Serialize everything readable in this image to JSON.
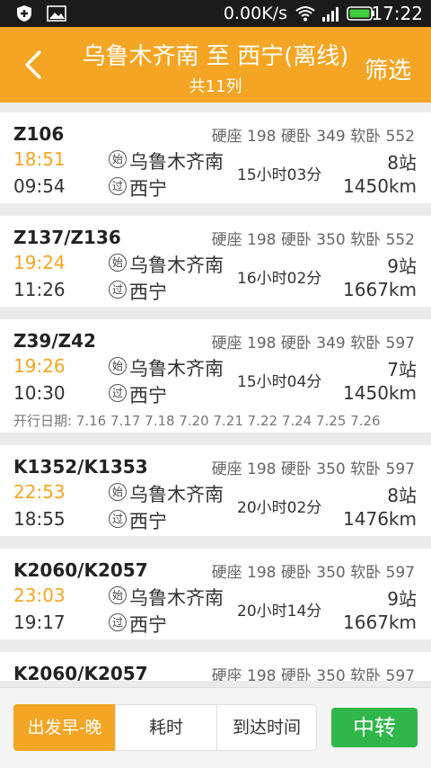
{
  "status_bar": {
    "net_speed": "0.00K/s",
    "time": "17:22",
    "icons": [
      "shield-icon",
      "image-icon",
      "wifi-icon",
      "signal-icon",
      "battery-icon"
    ]
  },
  "header": {
    "title": "乌鲁木齐南 至 西宁(离线)",
    "subtitle": "共11列",
    "filter_label": "筛选",
    "back_icon": "chevron-left-icon",
    "color": "#f4a523"
  },
  "badges": {
    "start": "始",
    "pass": "过"
  },
  "trains": [
    {
      "number": "Z106",
      "prices": "硬座 198 硬卧 349 软卧 552",
      "dep_time": "18:51",
      "arr_time": "09:54",
      "from": "乌鲁木齐南",
      "to": "西宁",
      "duration": "15小时03分",
      "stops": "8站",
      "distance": "1450km",
      "note": ""
    },
    {
      "number": "Z137/Z136",
      "prices": "硬座 198 硬卧 350 软卧 552",
      "dep_time": "19:24",
      "arr_time": "11:26",
      "from": "乌鲁木齐南",
      "to": "西宁",
      "duration": "16小时02分",
      "stops": "9站",
      "distance": "1667km",
      "note": ""
    },
    {
      "number": "Z39/Z42",
      "prices": "硬座 198 硬卧 349 软卧 597",
      "dep_time": "19:26",
      "arr_time": "10:30",
      "from": "乌鲁木齐南",
      "to": "西宁",
      "duration": "15小时04分",
      "stops": "7站",
      "distance": "1450km",
      "note": "开行日期: 7.16 7.17 7.18 7.20 7.21 7.22 7.24 7.25 7.26"
    },
    {
      "number": "K1352/K1353",
      "prices": "硬座 198 硬卧 350 软卧 597",
      "dep_time": "22:53",
      "arr_time": "18:55",
      "from": "乌鲁木齐南",
      "to": "西宁",
      "duration": "20小时02分",
      "stops": "8站",
      "distance": "1476km",
      "note": ""
    },
    {
      "number": "K2060/K2057",
      "prices": "硬座 198 硬卧 350 软卧 597",
      "dep_time": "23:03",
      "arr_time": "19:17",
      "from": "乌鲁木齐南",
      "to": "西宁",
      "duration": "20小时14分",
      "stops": "9站",
      "distance": "1667km",
      "note": ""
    },
    {
      "number": "K2060/K2057",
      "prices": "硬座 198 硬卧 350 软卧 597",
      "dep_time": "",
      "arr_time": "",
      "from": "",
      "to": "",
      "duration": "",
      "stops": "",
      "distance": "",
      "note": ""
    }
  ],
  "bottom": {
    "sort_options": [
      "出发早-晚",
      "耗时",
      "到达时间"
    ],
    "selected_sort": "出发早-晚",
    "transfer_label": "中转",
    "accent": "#f4a523",
    "transfer_color": "#2fb74a"
  }
}
